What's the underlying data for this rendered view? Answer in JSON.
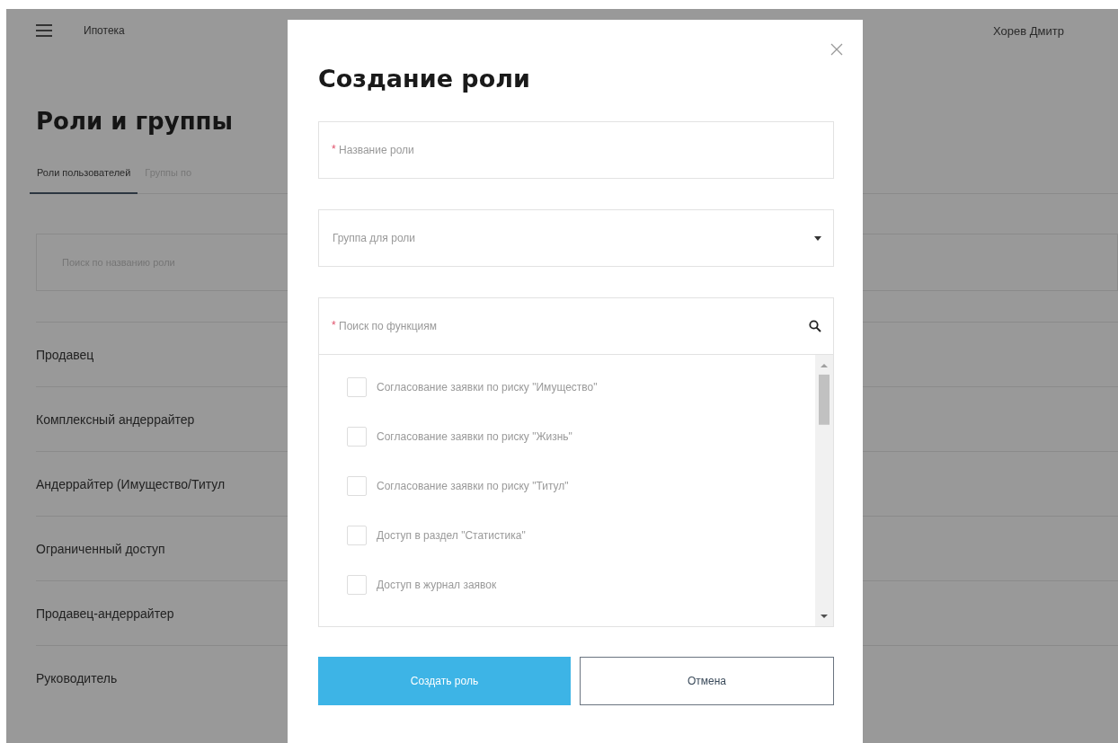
{
  "header": {
    "app_name": "Ипотека",
    "user_name": "Хорев Дмитр"
  },
  "page": {
    "title": "Роли и группы",
    "tabs": [
      {
        "label": "Роли пользователей",
        "selected": true
      },
      {
        "label": "Группы по",
        "selected": false
      }
    ],
    "search": {
      "placeholder": "Поиск по названию роли"
    },
    "roles": [
      "Продавец",
      "Комплексный андеррайтер",
      "Андеррайтер (Имущество/Титул",
      "Ограниченный доступ",
      "Продавец-андеррайтер",
      "Руководитель"
    ]
  },
  "dialog": {
    "title": "Создание роли",
    "name_field": {
      "required_mark": "*",
      "placeholder": "Название роли"
    },
    "group_select": {
      "placeholder": "Группа для роли"
    },
    "function_search": {
      "required_mark": "*",
      "placeholder": "Поиск по функциям"
    },
    "functions": [
      {
        "label": "Согласование заявки по риску \"Имущество\"",
        "checked": false
      },
      {
        "label": "Согласование заявки по риску \"Жизнь\"",
        "checked": false
      },
      {
        "label": "Согласование заявки по риску \"Титул\"",
        "checked": false
      },
      {
        "label": "Доступ в раздел \"Статистика\"",
        "checked": false
      },
      {
        "label": "Доступ в журнал заявок",
        "checked": false
      }
    ],
    "buttons": [
      {
        "kind": "primary",
        "label": "Создать роль"
      },
      {
        "kind": "secondary",
        "label": "Отмена"
      }
    ]
  }
}
